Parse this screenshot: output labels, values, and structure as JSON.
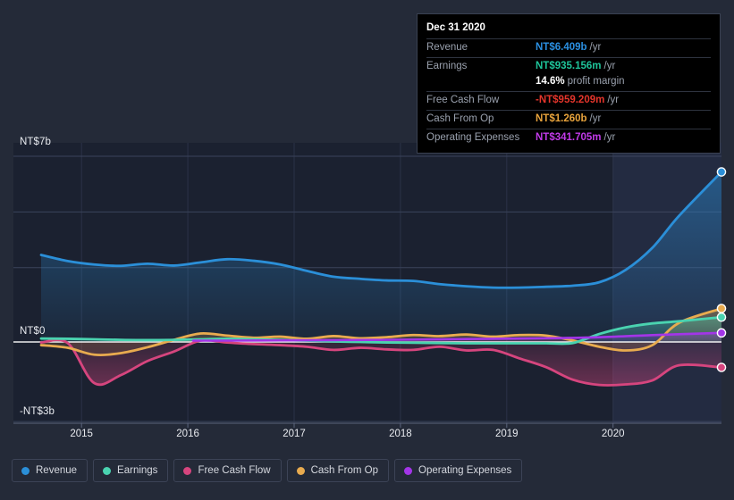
{
  "tooltip": {
    "title": "Dec 31 2020",
    "rows": [
      {
        "key": "Revenue",
        "value": "NT$6.409b",
        "unit": "/yr",
        "color": "#2b8fe0"
      },
      {
        "key": "Earnings",
        "value": "NT$935.156m",
        "unit": "/yr",
        "color": "#1ec49a"
      },
      {
        "key": "",
        "value": "14.6%",
        "unit": "profit margin",
        "color": "#ffffff"
      },
      {
        "key": "Free Cash Flow",
        "value": "-NT$959.209m",
        "unit": "/yr",
        "color": "#e5352b"
      },
      {
        "key": "Cash From Op",
        "value": "NT$1.260b",
        "unit": "/yr",
        "color": "#e8a33c"
      },
      {
        "key": "Operating Expenses",
        "value": "NT$341.705m",
        "unit": "/yr",
        "color": "#c13ae8"
      }
    ]
  },
  "legend": {
    "items": [
      {
        "label": "Revenue",
        "color": "#2b8fd8"
      },
      {
        "label": "Earnings",
        "color": "#4ad3b0"
      },
      {
        "label": "Free Cash Flow",
        "color": "#d6457e"
      },
      {
        "label": "Cash From Op",
        "color": "#e8ab4f"
      },
      {
        "label": "Operating Expenses",
        "color": "#a335e8"
      }
    ]
  },
  "chart_data": {
    "type": "area",
    "title": "",
    "xlabel": "",
    "ylabel": "",
    "currency": "NT$",
    "grid": true,
    "legend_position": "bottom",
    "y_axis": {
      "ticks": [
        {
          "label": "NT$7b",
          "value": 7
        },
        {
          "label": "NT$0",
          "value": 0
        },
        {
          "label": "-NT$3b",
          "value": -3
        }
      ],
      "ylim": [
        -3.4,
        7.6
      ],
      "gridlines": [
        7,
        4.9,
        2.8,
        0,
        -3
      ]
    },
    "x_axis": {
      "tick_labels": [
        "2015",
        "2016",
        "2017",
        "2018",
        "2019",
        "2020"
      ],
      "tick_values": [
        2015,
        2016,
        2017,
        2018,
        2019,
        2020
      ],
      "xlim": [
        2014.62,
        2021.02
      ],
      "highlight_region": {
        "from": 2020.0,
        "to": 2021.02,
        "label": ""
      }
    },
    "series": [
      {
        "name": "Revenue",
        "color": "#2b8fd8",
        "x": [
          2014.62,
          2014.87,
          2015.12,
          2015.37,
          2015.62,
          2015.87,
          2016.12,
          2016.37,
          2016.62,
          2016.87,
          2017.12,
          2017.37,
          2017.62,
          2017.87,
          2018.12,
          2018.37,
          2018.62,
          2018.87,
          2019.12,
          2019.37,
          2019.62,
          2019.87,
          2020.12,
          2020.37,
          2020.62,
          2021.02
        ],
        "values": [
          3.28,
          3.05,
          2.92,
          2.87,
          2.95,
          2.88,
          3.0,
          3.12,
          3.06,
          2.92,
          2.68,
          2.46,
          2.38,
          2.32,
          2.3,
          2.18,
          2.1,
          2.05,
          2.05,
          2.08,
          2.12,
          2.25,
          2.72,
          3.55,
          4.75,
          6.409
        ]
      },
      {
        "name": "Earnings",
        "color": "#4ad3b0",
        "x": [
          2014.62,
          2014.87,
          2015.12,
          2015.37,
          2015.62,
          2015.87,
          2016.12,
          2016.37,
          2016.62,
          2016.87,
          2017.12,
          2017.37,
          2017.62,
          2017.87,
          2018.12,
          2018.37,
          2018.62,
          2018.87,
          2019.12,
          2019.37,
          2019.62,
          2019.87,
          2020.12,
          2020.37,
          2020.62,
          2021.02
        ],
        "values": [
          0.13,
          0.12,
          0.1,
          0.08,
          0.07,
          0.08,
          0.1,
          0.12,
          0.1,
          0.08,
          0.05,
          0.02,
          0.0,
          -0.02,
          -0.03,
          -0.04,
          -0.05,
          -0.05,
          -0.05,
          -0.05,
          -0.04,
          0.3,
          0.55,
          0.7,
          0.78,
          0.935
        ]
      },
      {
        "name": "Free Cash Flow",
        "color": "#d6457e",
        "x": [
          2014.62,
          2014.87,
          2015.12,
          2015.37,
          2015.62,
          2015.87,
          2016.12,
          2016.37,
          2016.62,
          2016.87,
          2017.12,
          2017.37,
          2017.62,
          2017.87,
          2018.12,
          2018.37,
          2018.62,
          2018.87,
          2019.12,
          2019.37,
          2019.62,
          2019.87,
          2020.12,
          2020.37,
          2020.62,
          2021.02
        ],
        "values": [
          -0.02,
          -0.04,
          -1.55,
          -1.25,
          -0.72,
          -0.36,
          0.05,
          -0.02,
          -0.08,
          -0.12,
          -0.18,
          -0.3,
          -0.22,
          -0.28,
          -0.3,
          -0.18,
          -0.32,
          -0.3,
          -0.62,
          -0.95,
          -1.42,
          -1.62,
          -1.6,
          -1.45,
          -0.88,
          -0.959
        ]
      },
      {
        "name": "Cash From Op",
        "color": "#e8ab4f",
        "x": [
          2014.62,
          2014.87,
          2015.12,
          2015.37,
          2015.62,
          2015.87,
          2016.12,
          2016.37,
          2016.62,
          2016.87,
          2017.12,
          2017.37,
          2017.62,
          2017.87,
          2018.12,
          2018.37,
          2018.62,
          2018.87,
          2019.12,
          2019.37,
          2019.62,
          2019.87,
          2020.12,
          2020.37,
          2020.62,
          2021.02
        ],
        "values": [
          -0.12,
          -0.22,
          -0.48,
          -0.42,
          -0.2,
          0.08,
          0.32,
          0.24,
          0.16,
          0.2,
          0.12,
          0.22,
          0.14,
          0.18,
          0.26,
          0.22,
          0.28,
          0.2,
          0.26,
          0.24,
          0.06,
          -0.18,
          -0.32,
          -0.12,
          0.72,
          1.26
        ]
      },
      {
        "name": "Operating Expenses",
        "color": "#a335e8",
        "x": [
          2016.05,
          2016.37,
          2016.87,
          2017.37,
          2017.87,
          2018.37,
          2018.87,
          2019.37,
          2019.87,
          2020.37,
          2021.02
        ],
        "values": [
          0.05,
          0.05,
          0.06,
          0.07,
          0.08,
          0.1,
          0.12,
          0.14,
          0.18,
          0.26,
          0.342
        ]
      }
    ]
  }
}
